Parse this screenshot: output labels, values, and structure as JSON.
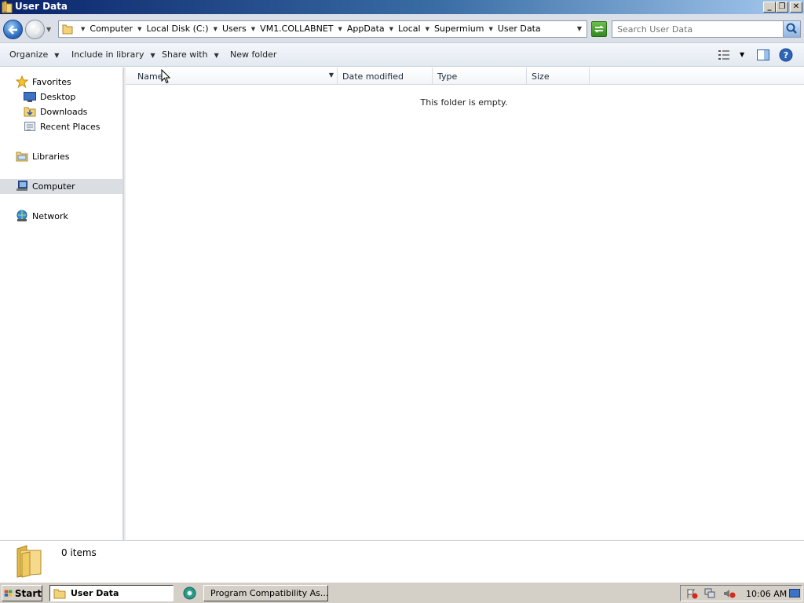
{
  "window": {
    "title": "User Data",
    "controls": [
      "minimize",
      "restore",
      "close"
    ]
  },
  "address_bar": {
    "breadcrumbs": [
      "Computer",
      "Local Disk (C:)",
      "Users",
      "VM1.COLLABNET",
      "AppData",
      "Local",
      "Supermium",
      "User Data"
    ]
  },
  "search": {
    "placeholder": "Search User Data"
  },
  "toolbar": {
    "organize": "Organize",
    "include_in_library": "Include in library",
    "share_with": "Share with",
    "new_folder": "New folder"
  },
  "nav_pane": {
    "favorites": "Favorites",
    "desktop": "Desktop",
    "downloads": "Downloads",
    "recent_places": "Recent Places",
    "libraries": "Libraries",
    "computer": "Computer",
    "network": "Network",
    "selected": "Computer"
  },
  "columns": {
    "name": "Name",
    "date_modified": "Date modified",
    "type": "Type",
    "size": "Size"
  },
  "content": {
    "empty_message": "This folder is empty."
  },
  "details_pane": {
    "item_count": "0 items"
  },
  "taskbar": {
    "start": "Start",
    "tasks": [
      "User Data",
      "Program Compatibility As..."
    ],
    "clock": "10:06 AM"
  },
  "colors": {
    "title_bar_start": "#0a246a",
    "title_bar_end": "#a6caf0",
    "taskbar": "#d4d0c8",
    "nav_selection": "#dadde2"
  }
}
